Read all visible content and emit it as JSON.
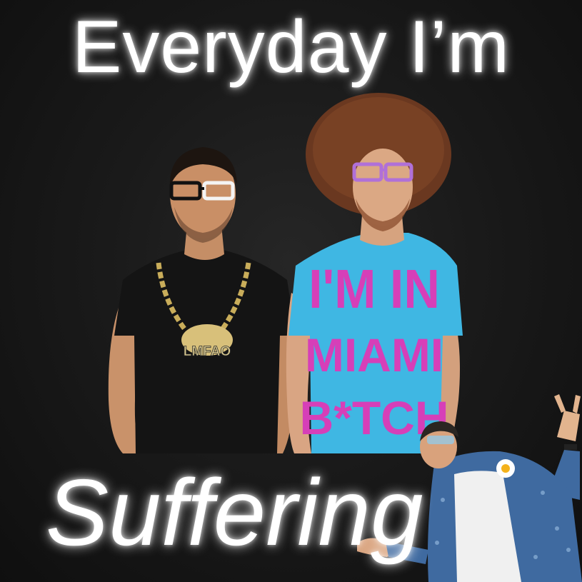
{
  "caption": {
    "top": "Everyday I’m",
    "bottom": "Suffering"
  },
  "shirts": {
    "left_logo_text": "LMFAO",
    "right_print_lines": [
      "I'M IN",
      "MIAMI",
      "B*TCH"
    ]
  },
  "colors": {
    "background": "#161616",
    "caption": "#ffffff",
    "right_shirt": "#3fb7e3",
    "right_shirt_print": "#d63fb8",
    "left_shirt": "#141414",
    "chain": "#c9ad5a",
    "purple_glasses": "#b070d8",
    "white_glasses": "#f4f4f4",
    "denim": "#3f6aa0"
  }
}
